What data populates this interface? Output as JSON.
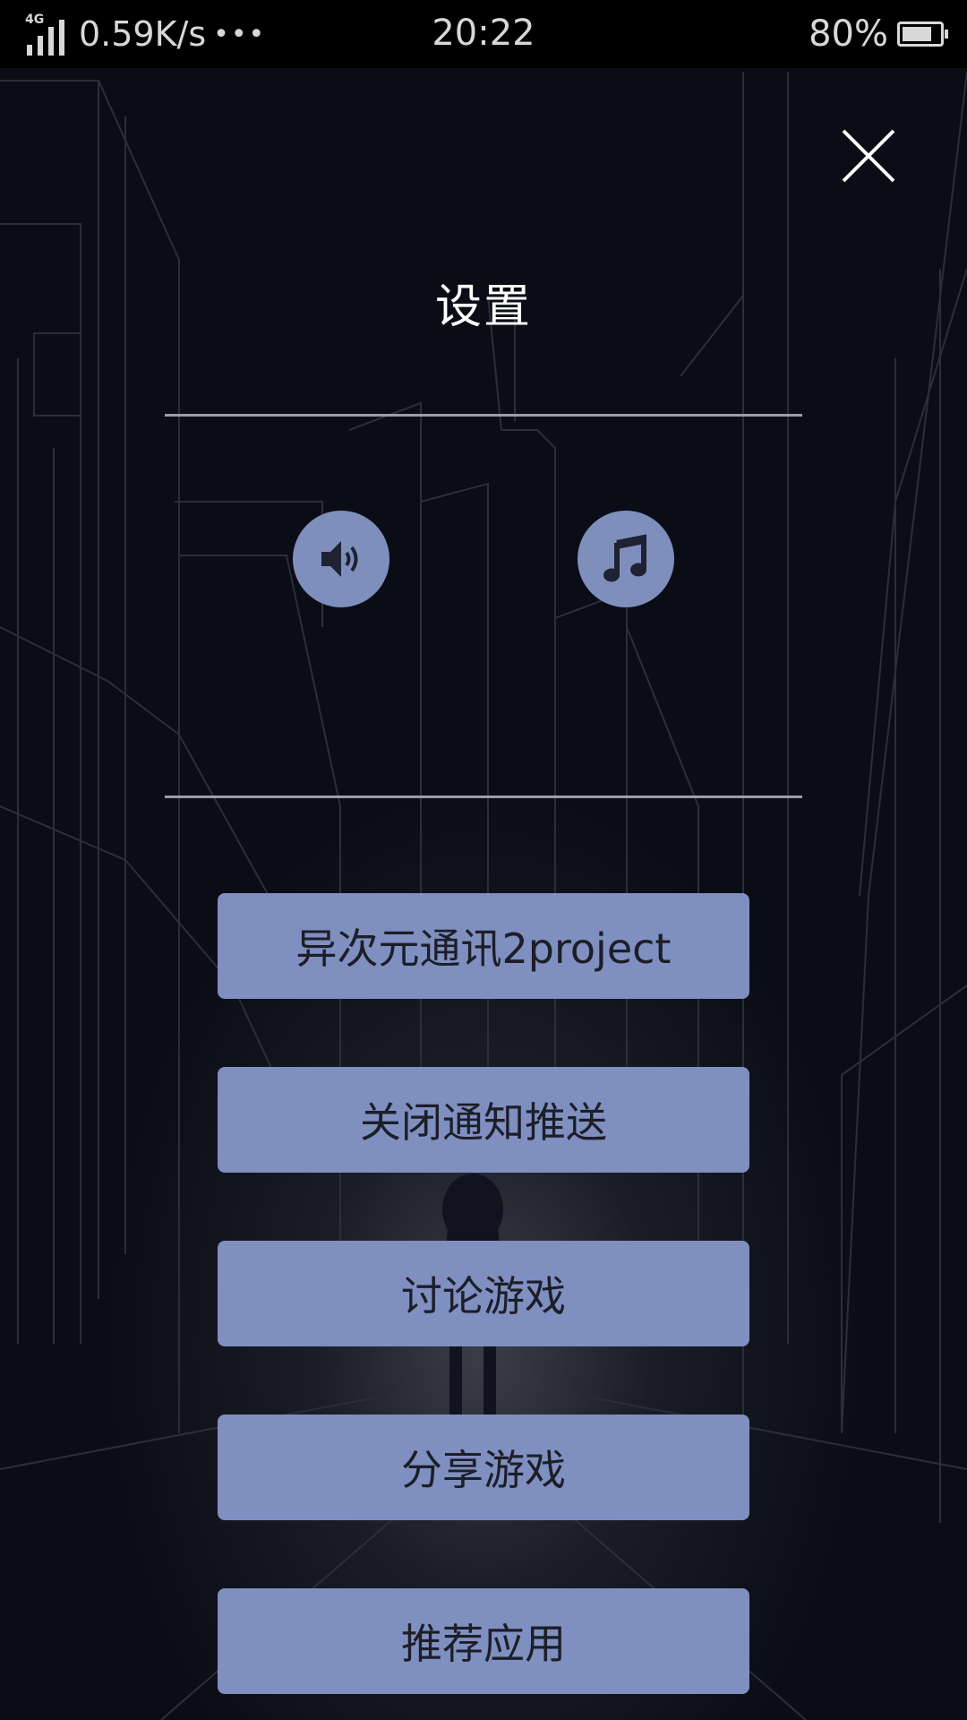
{
  "status_bar": {
    "network_type": "4G",
    "net_speed": "0.59K/s",
    "more_dots": "•••",
    "time": "20:22",
    "battery_percent": "80%",
    "battery_level": 0.8
  },
  "settings": {
    "title": "设置",
    "close_icon": "close-icon",
    "sound_icon": "speaker-icon",
    "music_icon": "music-note-icon",
    "buttons": [
      {
        "label": "异次元通讯2project"
      },
      {
        "label": "关闭通知推送"
      },
      {
        "label": "讨论游戏"
      },
      {
        "label": "分享游戏"
      },
      {
        "label": "推荐应用"
      }
    ]
  },
  "colors": {
    "button_bg": "#7f8fc0",
    "button_text": "#1c1e28",
    "background": "#0b0d16"
  }
}
